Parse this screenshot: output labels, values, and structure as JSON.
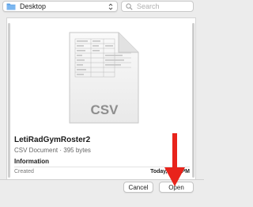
{
  "toolbar": {
    "location_label": "Desktop",
    "search_placeholder": "Search"
  },
  "preview": {
    "icon_label": "CSV",
    "file_name": "LetiRadGymRoster2",
    "file_kind": "CSV Document · 395 bytes",
    "info_heading": "Information",
    "created_label": "Created",
    "created_value": "Today, 2:31 PM"
  },
  "buttons": {
    "cancel_label": "Cancel",
    "open_label": "Open"
  },
  "colors": {
    "annotation_arrow": "#e8231b",
    "folder_blue": "#5aa0e6"
  }
}
